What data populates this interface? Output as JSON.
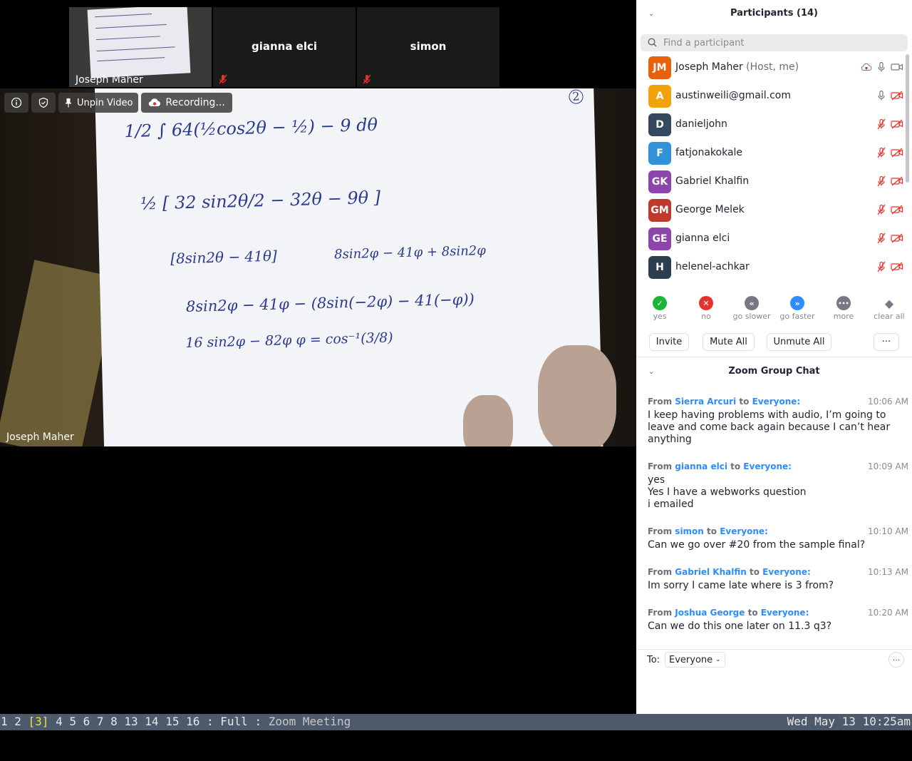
{
  "thumbnails": [
    {
      "name": "Joseph Maher",
      "muted": true
    },
    {
      "name": "gianna elci",
      "muted": true
    },
    {
      "name": "simon",
      "muted": true
    }
  ],
  "main_video": {
    "speaker_name": "Joseph Maher",
    "page_number": "2",
    "math_lines": [
      "1/2 ∫ 64(½cos2θ − ½) − 9 dθ",
      "½ [ 32 sin2θ/2 − 32θ − 9θ ]",
      "[8sin2θ − 41θ]",
      "8sin2φ − 41φ + 8sin2φ",
      "8sin2φ − 41φ − (8sin(−2φ) − 41(−φ))",
      "16 sin2φ − 82φ    φ = cos⁻¹(3/8)"
    ]
  },
  "toolbar": {
    "unpin_label": "Unpin Video",
    "recording_label": "Recording..."
  },
  "participants_panel": {
    "title": "Participants (14)",
    "search_placeholder": "Find a participant",
    "participants": [
      {
        "initials": "JM",
        "name": "Joseph Maher",
        "tag": "(Host, me)",
        "color": "#e8600a",
        "audio_muted": false,
        "video_off": false
      },
      {
        "initials": "A",
        "name": "austinweili@gmail.com",
        "tag": "",
        "color": "#f2a20c",
        "audio_muted": false,
        "video_off": true
      },
      {
        "initials": "D",
        "name": "danieljohn",
        "tag": "",
        "color": "#34495e",
        "audio_muted": true,
        "video_off": true
      },
      {
        "initials": "F",
        "name": "fatjonakokale",
        "tag": "",
        "color": "#3192d8",
        "audio_muted": true,
        "video_off": true
      },
      {
        "initials": "GK",
        "name": "Gabriel Khalfin",
        "tag": "",
        "color": "#8e44ad",
        "audio_muted": true,
        "video_off": true
      },
      {
        "initials": "GM",
        "name": "George Melek",
        "tag": "",
        "color": "#c0392b",
        "audio_muted": true,
        "video_off": true
      },
      {
        "initials": "GE",
        "name": "gianna elci",
        "tag": "",
        "color": "#8e44ad",
        "audio_muted": true,
        "video_off": true
      },
      {
        "initials": "H",
        "name": "helenel-achkar",
        "tag": "",
        "color": "#2c3e50",
        "audio_muted": true,
        "video_off": true
      }
    ],
    "reactions": [
      {
        "label": "yes",
        "symbol": "✓",
        "color": "#1bb53a"
      },
      {
        "label": "no",
        "symbol": "✕",
        "color": "#e5322d"
      },
      {
        "label": "go slower",
        "symbol": "«",
        "color": "#777785"
      },
      {
        "label": "go faster",
        "symbol": "»",
        "color": "#2d8cff"
      },
      {
        "label": "more",
        "symbol": "•••",
        "color": "#777785"
      },
      {
        "label": "clear all",
        "symbol": "◆",
        "color": "#777785"
      }
    ],
    "buttons": {
      "invite": "Invite",
      "mute_all": "Mute All",
      "unmute_all": "Unmute All",
      "more": "···"
    }
  },
  "chat": {
    "title": "Zoom Group Chat",
    "messages": [
      {
        "from_label": "From",
        "sender": "Sierra Arcuri",
        "to_label": "to",
        "recipient": "Everyone:",
        "time": "10:06 AM",
        "text": "I keep having problems with audio, I’m going to leave and come back again because I can’t hear anything"
      },
      {
        "from_label": "From",
        "sender": "gianna elci",
        "to_label": "to",
        "recipient": "Everyone:",
        "time": "10:09 AM",
        "text": "yes\nYes I have a webworks question\ni emailed"
      },
      {
        "from_label": "From",
        "sender": "simon",
        "to_label": "to",
        "recipient": "Everyone:",
        "time": "10:10 AM",
        "text": "Can we go over #20 from the sample final?"
      },
      {
        "from_label": "From",
        "sender": "Gabriel Khalfin",
        "to_label": "to",
        "recipient": "Everyone:",
        "time": "10:13 AM",
        "text": "Im sorry I came late where is 3 from?"
      },
      {
        "from_label": "From",
        "sender": "Joshua George",
        "to_label": "to",
        "recipient": "Everyone:",
        "time": "10:20 AM",
        "text": "Can we do this one later on 11.3 q3?"
      }
    ],
    "to_label": "To:",
    "to_value": "Everyone",
    "more": "···"
  },
  "status_bar": {
    "workspaces_before": "1 2 ",
    "current": "[3]",
    "workspaces_after": " 4 5 6 7 8 13 14 15 16 ",
    "separator1": ":",
    "layout": " Full ",
    "separator2": ":",
    "window_title": " Zoom Meeting",
    "datetime": "Wed May 13 10:25am"
  }
}
